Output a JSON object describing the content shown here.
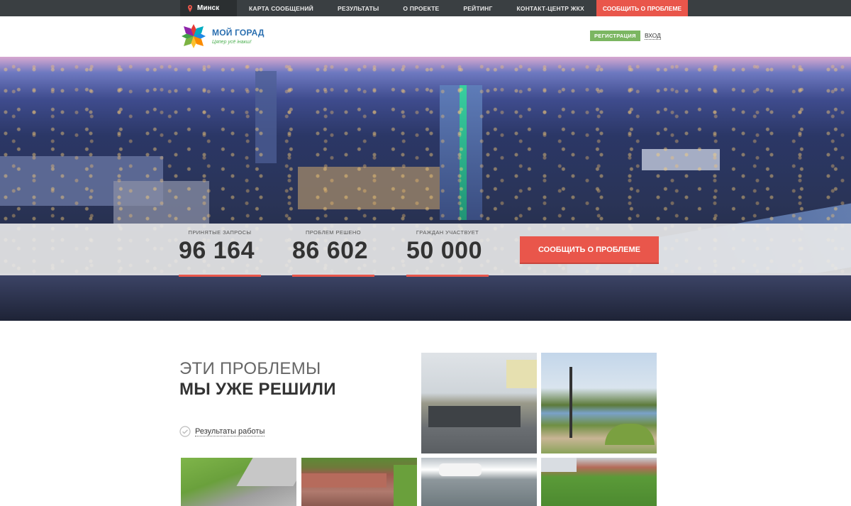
{
  "topnav": {
    "city": "Минск",
    "items": [
      "КАРТА СООБЩЕНИЙ",
      "РЕЗУЛЬТАТЫ",
      "О ПРОЕКТЕ",
      "РЕЙТИНГ",
      "КОНТАКТ-ЦЕНТР ЖКХ"
    ],
    "report": "СООБЩИТЬ О ПРОБЛЕМЕ"
  },
  "header": {
    "logo_title": "МОЙ ГОРАД",
    "logo_subtitle": "Цяпер усё інакш!",
    "register": "РЕГИСТРАЦИЯ",
    "login": "ВХОД"
  },
  "hero": {
    "stats": [
      {
        "label": "ПРИНЯТЫЕ ЗАПРОСЫ",
        "value": "96 164"
      },
      {
        "label": "ПРОБЛЕМ РЕШЕНО",
        "value": "86 602"
      },
      {
        "label": "ГРАЖДАН УЧАСТВУЕТ",
        "value": "50 000"
      }
    ],
    "report_button": "СООБЩИТЬ О ПРОБЛЕМЕ"
  },
  "solved": {
    "title_light": "ЭТИ ПРОБЛЕМЫ",
    "title_bold": "МЫ УЖЕ РЕШИЛИ",
    "results_link": "Результаты работы"
  },
  "colors": {
    "accent": "#e9564b",
    "nav_bg": "#3a3f42",
    "register_green": "#7bb661",
    "logo_blue": "#2b6fb0"
  }
}
